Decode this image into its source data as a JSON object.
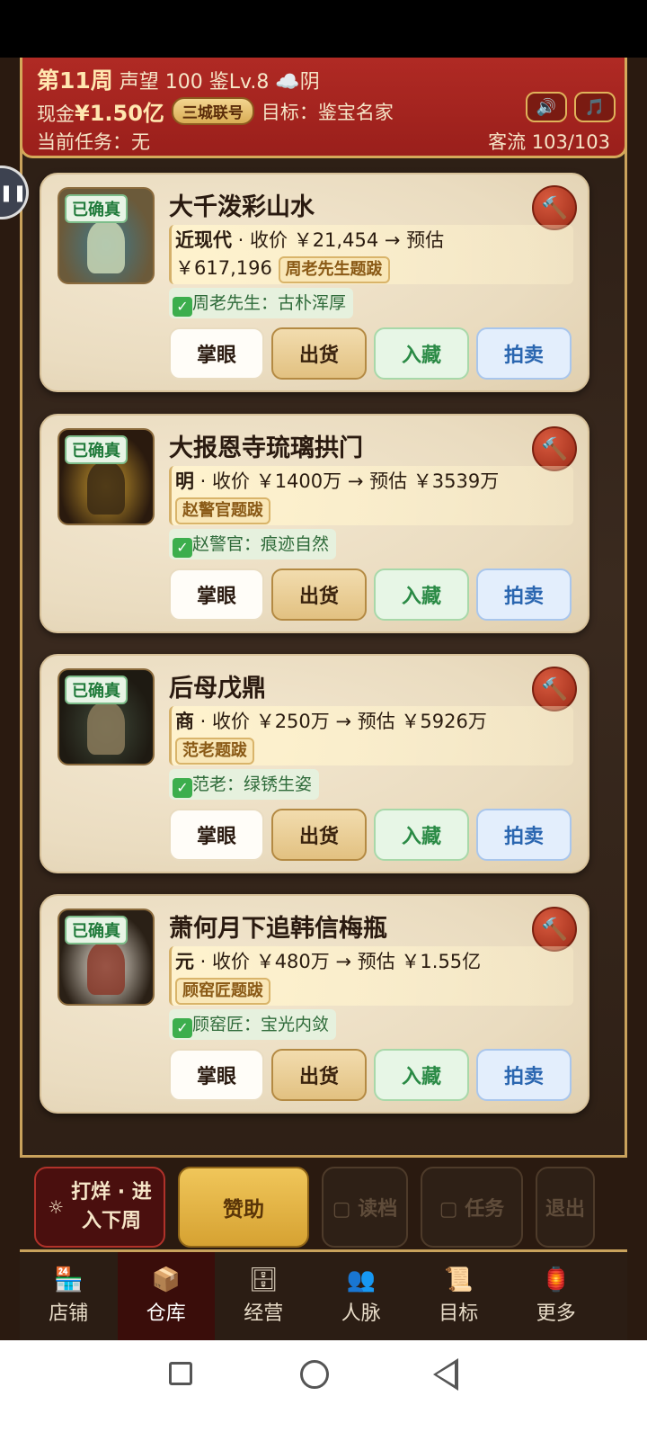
{
  "header": {
    "week": "第11周",
    "fame": "声望 100",
    "appraise": "鉴Lv.8",
    "weather": "☁️阴",
    "cash_label": "现金",
    "cash": "¥1.50亿",
    "city_badge": "三城联号",
    "goal": "目标：鉴宝名家",
    "task": "当前任务：无",
    "customers": "客流 103/103",
    "sound_icon": "🔊",
    "music_icon": "🎵"
  },
  "side_tab": {
    "label": "❚❚"
  },
  "cards": [
    {
      "tag": "已确真",
      "title": "大千泼彩山水",
      "era": "近现代",
      "price_line": " · 收价 ￥21,454 → 预估",
      "price_line2": "￥617,196",
      "sign": "周老先生题跋",
      "verdict": "周老先生：古朴浑厚",
      "thumb_colors": [
        "#6b5a3a",
        "#3f7a8c",
        "#c9d7b5"
      ]
    },
    {
      "tag": "已确真",
      "title": "大报恩寺琉璃拱门",
      "era": "明",
      "price_line": " · 收价 ￥1400万 → 预估 ￥3539万",
      "price_line2": "",
      "sign": "赵警官题跋",
      "verdict": "赵警官：痕迹自然",
      "thumb_colors": [
        "#2a1a0e",
        "#c99a2e",
        "#3b2a14"
      ]
    },
    {
      "tag": "已确真",
      "title": "后母戊鼎",
      "era": "商",
      "price_line": " · 收价 ￥250万 → 预估 ￥5926万",
      "price_line2": "",
      "sign": "范老题跋",
      "verdict": "范老：绿锈生姿",
      "thumb_colors": [
        "#1e1a12",
        "#3f4a3a",
        "#8a7a5a"
      ]
    },
    {
      "tag": "已确真",
      "title": "萧何月下追韩信梅瓶",
      "era": "元",
      "price_line": " · 收价 ￥480万 → 预估 ￥1.55亿",
      "price_line2": "",
      "sign": "顾窑匠题跋",
      "verdict": "顾窑匠：宝光内敛",
      "thumb_colors": [
        "#2a2016",
        "#efe8dc",
        "#8a3a2a"
      ]
    }
  ],
  "card_actions": {
    "inspect": "掌眼",
    "sell": "出货",
    "collect": "入藏",
    "auction": "拍卖",
    "hammer_icon": "🔨"
  },
  "action_bar": {
    "work_icon": "☼",
    "work_line1": "打烊 · 进",
    "work_line2": "入下周",
    "sponsor": "赞助",
    "load": "▢ 读档",
    "task": "▢ 任务",
    "exit": "退出"
  },
  "nav": [
    {
      "icon": "🏪",
      "label": "店铺",
      "active": false
    },
    {
      "icon": "📦",
      "label": "仓库",
      "active": true
    },
    {
      "icon": "🗄",
      "label": "经营",
      "active": false
    },
    {
      "icon": "👥",
      "label": "人脉",
      "active": false
    },
    {
      "icon": "📜",
      "label": "目标",
      "active": false
    },
    {
      "icon": "🏮",
      "label": "更多",
      "active": false
    }
  ]
}
